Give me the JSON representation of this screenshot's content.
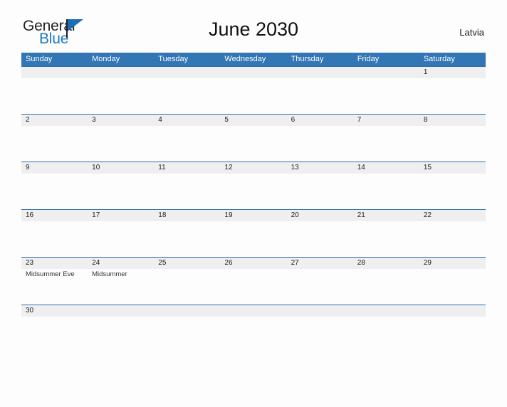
{
  "brand": {
    "name_part1": "General",
    "name_part2": "Blue",
    "triangle_color": "#1c6fb5"
  },
  "header": {
    "title": "June 2030",
    "country": "Latvia"
  },
  "colors": {
    "header_blue": "#3276b5",
    "row_rule_blue": "#2f6fae",
    "date_band_gray": "#efefef",
    "brand_blue": "#1c79c0",
    "page_background": "#fdfdfd"
  },
  "calendar": {
    "weekdays": [
      "Sunday",
      "Monday",
      "Tuesday",
      "Wednesday",
      "Thursday",
      "Friday",
      "Saturday"
    ],
    "weeks": [
      {
        "days": [
          {
            "num": "",
            "event": ""
          },
          {
            "num": "",
            "event": ""
          },
          {
            "num": "",
            "event": ""
          },
          {
            "num": "",
            "event": ""
          },
          {
            "num": "",
            "event": ""
          },
          {
            "num": "",
            "event": ""
          },
          {
            "num": "1",
            "event": ""
          }
        ]
      },
      {
        "days": [
          {
            "num": "2",
            "event": ""
          },
          {
            "num": "3",
            "event": ""
          },
          {
            "num": "4",
            "event": ""
          },
          {
            "num": "5",
            "event": ""
          },
          {
            "num": "6",
            "event": ""
          },
          {
            "num": "7",
            "event": ""
          },
          {
            "num": "8",
            "event": ""
          }
        ]
      },
      {
        "days": [
          {
            "num": "9",
            "event": ""
          },
          {
            "num": "10",
            "event": ""
          },
          {
            "num": "11",
            "event": ""
          },
          {
            "num": "12",
            "event": ""
          },
          {
            "num": "13",
            "event": ""
          },
          {
            "num": "14",
            "event": ""
          },
          {
            "num": "15",
            "event": ""
          }
        ]
      },
      {
        "days": [
          {
            "num": "16",
            "event": ""
          },
          {
            "num": "17",
            "event": ""
          },
          {
            "num": "18",
            "event": ""
          },
          {
            "num": "19",
            "event": ""
          },
          {
            "num": "20",
            "event": ""
          },
          {
            "num": "21",
            "event": ""
          },
          {
            "num": "22",
            "event": ""
          }
        ]
      },
      {
        "days": [
          {
            "num": "23",
            "event": "Midsummer Eve"
          },
          {
            "num": "24",
            "event": "Midsummer"
          },
          {
            "num": "25",
            "event": ""
          },
          {
            "num": "26",
            "event": ""
          },
          {
            "num": "27",
            "event": ""
          },
          {
            "num": "28",
            "event": ""
          },
          {
            "num": "29",
            "event": ""
          }
        ]
      },
      {
        "short": true,
        "days": [
          {
            "num": "30",
            "event": ""
          },
          {
            "num": "",
            "event": ""
          },
          {
            "num": "",
            "event": ""
          },
          {
            "num": "",
            "event": ""
          },
          {
            "num": "",
            "event": ""
          },
          {
            "num": "",
            "event": ""
          },
          {
            "num": "",
            "event": ""
          }
        ]
      }
    ]
  }
}
